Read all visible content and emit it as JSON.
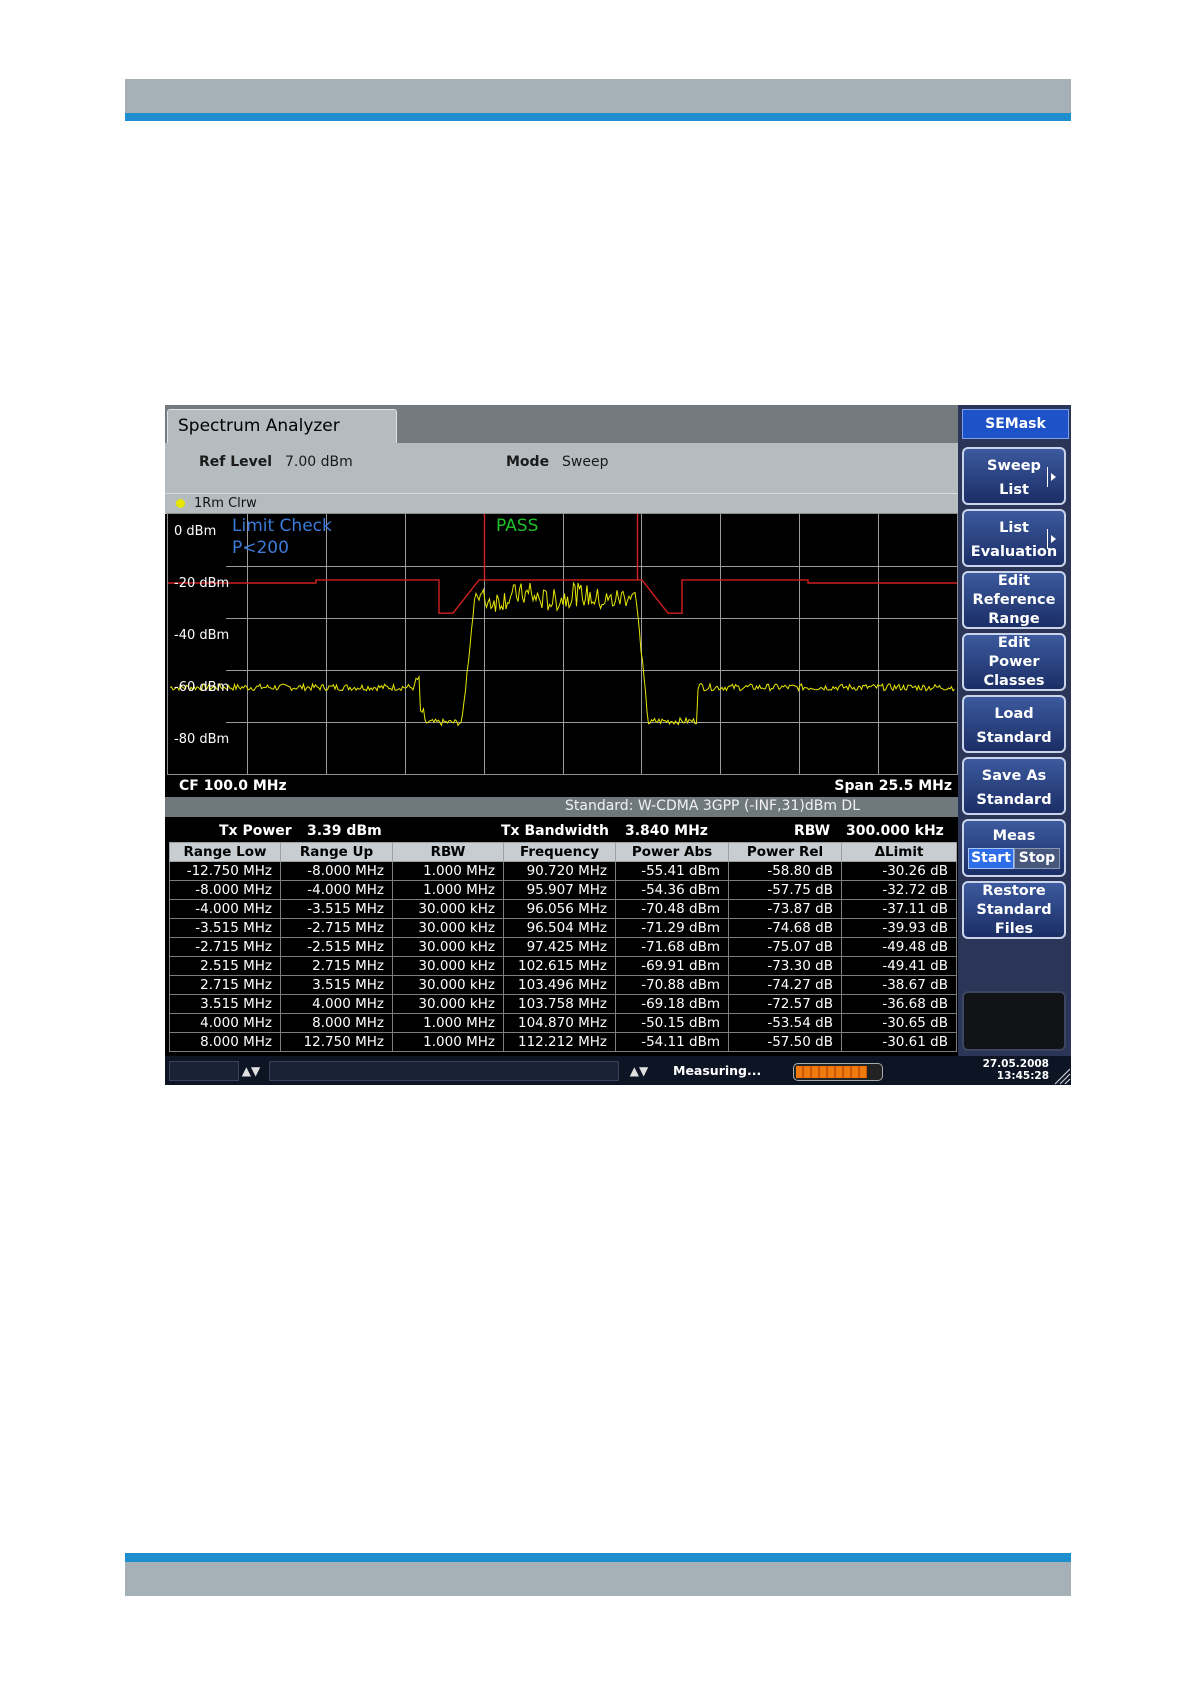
{
  "app": {
    "tab_title": "Spectrum Analyzer"
  },
  "params": {
    "ref_level_label": "Ref Level",
    "ref_level_value": "7.00 dBm",
    "mode_label": "Mode",
    "mode_value": "Sweep"
  },
  "trace": {
    "label": "1Rm Clrw",
    "indicator_color": "#e6e600"
  },
  "plot": {
    "y_labels": [
      "0 dBm",
      "-20 dBm",
      "-40 dBm",
      "-60 dBm",
      "-80 dBm"
    ],
    "limit_check_title": "Limit Check",
    "limit_check_condition": "P<200",
    "pass_text": "PASS",
    "trace_color": "#e6e600",
    "limit_color": "#d02020",
    "pass_color": "#1fbf2a"
  },
  "freq": {
    "center": "CF 100.0 MHz",
    "span": "Span 25.5 MHz"
  },
  "standard_text": "Standard: W-CDMA 3GPP (-INF,31)dBm DL",
  "summary": {
    "tx_power_label": "Tx Power",
    "tx_power_value": "3.39 dBm",
    "tx_bw_label": "Tx Bandwidth",
    "tx_bw_value": "3.840 MHz",
    "rbw_label": "RBW",
    "rbw_value": "300.000 kHz"
  },
  "table": {
    "headers": [
      "Range Low",
      "Range Up",
      "RBW",
      "Frequency",
      "Power Abs",
      "Power Rel",
      "ΔLimit"
    ],
    "rows": [
      [
        "-12.750 MHz",
        "-8.000 MHz",
        "1.000 MHz",
        "90.720 MHz",
        "-55.41 dBm",
        "-58.80 dB",
        "-30.26 dB"
      ],
      [
        "-8.000 MHz",
        "-4.000 MHz",
        "1.000 MHz",
        "95.907 MHz",
        "-54.36 dBm",
        "-57.75 dB",
        "-32.72 dB"
      ],
      [
        "-4.000 MHz",
        "-3.515 MHz",
        "30.000 kHz",
        "96.056 MHz",
        "-70.48 dBm",
        "-73.87 dB",
        "-37.11 dB"
      ],
      [
        "-3.515 MHz",
        "-2.715 MHz",
        "30.000 kHz",
        "96.504 MHz",
        "-71.29 dBm",
        "-74.68 dB",
        "-39.93 dB"
      ],
      [
        "-2.715 MHz",
        "-2.515 MHz",
        "30.000 kHz",
        "97.425 MHz",
        "-71.68 dBm",
        "-75.07 dB",
        "-49.48 dB"
      ],
      [
        "2.515 MHz",
        "2.715 MHz",
        "30.000 kHz",
        "102.615 MHz",
        "-69.91 dBm",
        "-73.30 dB",
        "-49.41 dB"
      ],
      [
        "2.715 MHz",
        "3.515 MHz",
        "30.000 kHz",
        "103.496 MHz",
        "-70.88 dBm",
        "-74.27 dB",
        "-38.67 dB"
      ],
      [
        "3.515 MHz",
        "4.000 MHz",
        "30.000 kHz",
        "103.758 MHz",
        "-69.18 dBm",
        "-72.57 dB",
        "-36.68 dB"
      ],
      [
        "4.000 MHz",
        "8.000 MHz",
        "1.000 MHz",
        "104.870 MHz",
        "-50.15 dBm",
        "-53.54 dB",
        "-30.65 dB"
      ],
      [
        "8.000 MHz",
        "12.750 MHz",
        "1.000 MHz",
        "112.212 MHz",
        "-54.11 dBm",
        "-57.50 dB",
        "-30.61 dB"
      ]
    ]
  },
  "softkeys": {
    "menu_title": "SEMask",
    "sweep_list": [
      "Sweep",
      "List"
    ],
    "list_evaluation": [
      "List",
      "Evaluation"
    ],
    "edit_reference_range": [
      "Edit",
      "Reference",
      "Range"
    ],
    "edit_power_classes": [
      "Edit",
      "Power",
      "Classes"
    ],
    "load_standard": [
      "Load",
      "Standard"
    ],
    "save_as_standard": [
      "Save As",
      "Standard"
    ],
    "meas": "Meas",
    "meas_start": "Start",
    "meas_stop": "Stop",
    "restore_standard_files": [
      "Restore",
      "Standard",
      "Files"
    ]
  },
  "status": {
    "measuring_text": "Measuring...",
    "progress_fraction": 0.85,
    "date": "27.05.2008",
    "time": "13:45:28"
  }
}
